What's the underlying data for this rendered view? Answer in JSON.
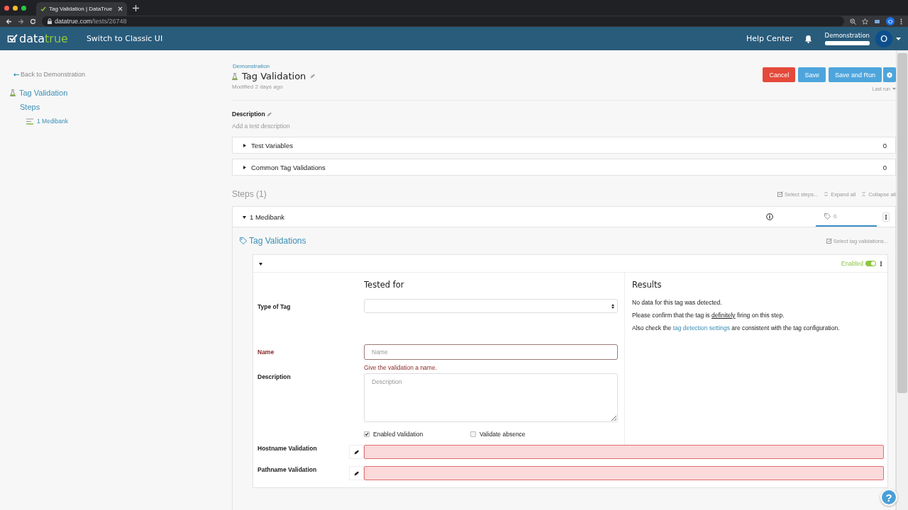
{
  "browser": {
    "tab_title": "Tag Validation | DataTrue",
    "url_host": "datatrue.com",
    "url_path": "/tests/26748",
    "avatar": "O"
  },
  "header": {
    "logo_left": "data",
    "logo_right": "true",
    "switch_link": "Switch to Classic UI",
    "help": "Help Center",
    "account": "Demonstration",
    "avatar": "O"
  },
  "sidebar": {
    "back": "Back to Demonstration",
    "items": [
      {
        "label": "Tag Validation",
        "kind": "test",
        "children": [
          {
            "label": "Steps",
            "kind": "section",
            "children": [
              {
                "label": "1 Medibank",
                "kind": "step"
              }
            ]
          }
        ]
      }
    ]
  },
  "page": {
    "breadcrumb": "Demonstration",
    "title": "Tag Validation",
    "modified": "Modified 2 days ago",
    "actions": [
      {
        "label": "Cancel",
        "kind": "danger"
      },
      {
        "label": "Save",
        "kind": "primary"
      },
      {
        "label": "Save and Run",
        "kind": "primary"
      },
      {
        "kind": "settings"
      }
    ],
    "last_run": "Last run",
    "description_label": "Description",
    "description_placeholder": "Add a test description",
    "panels": [
      {
        "label": "Test Variables",
        "count": "0",
        "expanded": false
      },
      {
        "label": "Common Tag Validations",
        "count": "0",
        "expanded": false
      }
    ],
    "steps_heading": "Steps (1)",
    "step_tools": [
      {
        "label": "Select steps...",
        "kind": "select"
      },
      {
        "label": "Expand all",
        "kind": "expand"
      },
      {
        "label": "Collapse all",
        "kind": "collapse"
      }
    ],
    "step": {
      "label": "1 Medibank",
      "expanded": true,
      "tag_count": "0"
    },
    "tag_validations": {
      "heading": "Tag Validations",
      "select": "Select tag validations...",
      "validation": {
        "expanded": true,
        "enabled_label": "Enabled",
        "enabled": true,
        "tested_for": "Tested for",
        "results_heading": "Results",
        "fields": [
          {
            "label": "Type of Tag",
            "kind": "select",
            "invalid": false
          },
          {
            "label": "Name",
            "kind": "text",
            "placeholder": "Name",
            "invalid": true,
            "error": "Give the validation a name."
          },
          {
            "label": "Description",
            "kind": "textarea",
            "placeholder": "Description",
            "invalid": false
          }
        ],
        "checkboxes": [
          {
            "label": "Enabled Validation",
            "checked": true
          },
          {
            "label": "Validate absence",
            "checked": false
          }
        ],
        "pattern_fields": [
          {
            "label": "Hostname Validation",
            "invalid": true
          },
          {
            "label": "Pathname Validation",
            "invalid": true
          }
        ],
        "results": [
          [
            {
              "text": "No data for this tag was detected."
            }
          ],
          [
            {
              "text": "Please confirm that the tag is "
            },
            {
              "text": "definitely",
              "kind": "term"
            },
            {
              "text": " firing on this step."
            }
          ],
          [
            {
              "text": "Also check the "
            },
            {
              "text": "tag detection settings",
              "kind": "link"
            },
            {
              "text": " are consistent with the tag configuration."
            }
          ]
        ]
      }
    },
    "help_button": "?"
  }
}
